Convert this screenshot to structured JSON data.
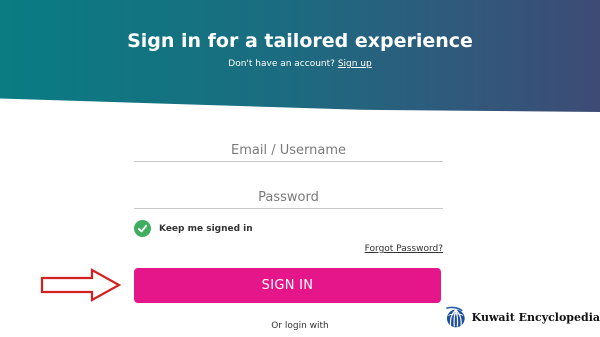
{
  "header": {
    "title": "Sign in for a tailored experience",
    "no_account_text": "Don't have an account?",
    "signup_link": "Sign up",
    "gradient_start": "#0a7c82",
    "gradient_end": "#3e4b75"
  },
  "form": {
    "email_placeholder": "Email / Username",
    "email_value": "",
    "password_placeholder": "Password",
    "password_value": "",
    "keep_signed_in_label": "Keep me signed in",
    "keep_signed_in_checked": true,
    "forgot_password_link": "Forgot Password?",
    "sign_in_label": "SIGN IN",
    "or_login_text": "Or login with",
    "accent_color": "#e4168a",
    "check_color": "#3fae60"
  },
  "watermark": {
    "text": "Kuwait Encyclopedia",
    "icon": "kuwait-encyclopedia-logo"
  },
  "annotation": {
    "icon": "red-outline-arrow-icon",
    "color": "#d32020"
  }
}
